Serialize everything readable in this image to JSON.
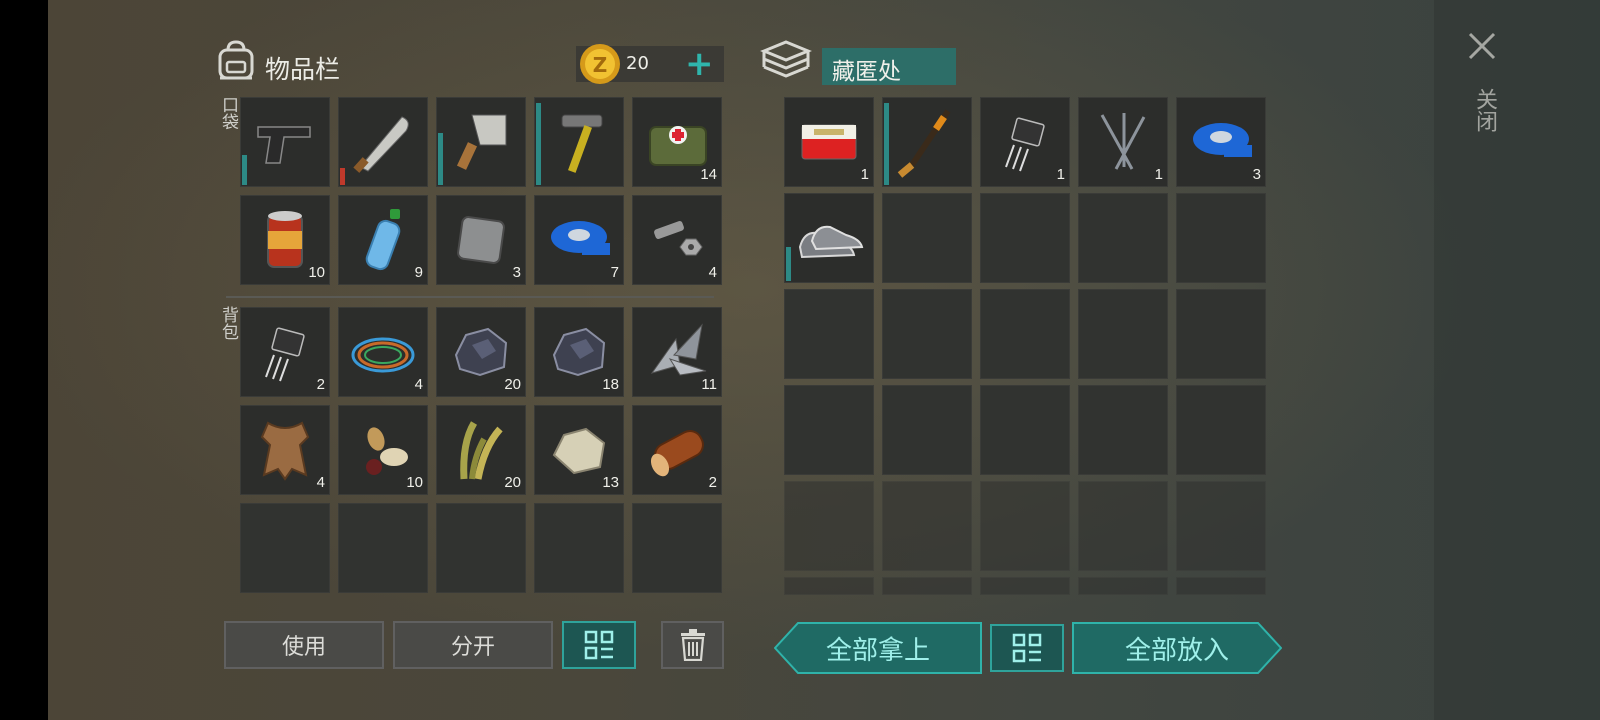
{
  "inventory": {
    "title": "物品栏",
    "coins": "20",
    "pocket_label": "口袋",
    "backpack_label": "背包",
    "pocket_items": [
      {
        "icon": "pistol-icon",
        "count": "",
        "durability": 0.35,
        "dur_color": "#2d8a86"
      },
      {
        "icon": "machete-icon",
        "count": "",
        "durability": 0.2,
        "dur_color": "#c0392b"
      },
      {
        "icon": "cleaver-icon",
        "count": "",
        "durability": 0.6,
        "dur_color": "#2d8a86"
      },
      {
        "icon": "hammer-icon",
        "count": "",
        "durability": 0.95,
        "dur_color": "#2d8a86"
      },
      {
        "icon": "medkit-bag-icon",
        "count": "14"
      },
      {
        "icon": "canned-food-icon",
        "count": "10"
      },
      {
        "icon": "water-bottle-icon",
        "count": "9"
      },
      {
        "icon": "metal-plate-icon",
        "count": "3"
      },
      {
        "icon": "duct-tape-icon",
        "count": "7"
      },
      {
        "icon": "bolt-nut-icon",
        "count": "4"
      }
    ],
    "backpack_items": [
      {
        "icon": "transistor-icon",
        "count": "2"
      },
      {
        "icon": "wire-coil-icon",
        "count": "4"
      },
      {
        "icon": "iron-ore-icon",
        "count": "20"
      },
      {
        "icon": "iron-ore-icon",
        "count": "18"
      },
      {
        "icon": "scrap-metal-icon",
        "count": "11"
      },
      {
        "icon": "leather-hide-icon",
        "count": "4"
      },
      {
        "icon": "seeds-icon",
        "count": "10"
      },
      {
        "icon": "plant-fiber-icon",
        "count": "20"
      },
      {
        "icon": "stone-icon",
        "count": "13"
      },
      {
        "icon": "wood-log-icon",
        "count": "2"
      }
    ],
    "buttons": {
      "use": "使用",
      "split": "分开"
    }
  },
  "stash": {
    "title": "藏匿处",
    "items": [
      {
        "icon": "cigarettes-icon",
        "count": "1"
      },
      {
        "icon": "hockey-stick-icon",
        "count": "",
        "durability": 0.95,
        "dur_color": "#2d8a86"
      },
      {
        "icon": "transistor-icon",
        "count": "1"
      },
      {
        "icon": "nails-icon",
        "count": "1"
      },
      {
        "icon": "duct-tape-icon",
        "count": "3"
      },
      {
        "icon": "sneakers-icon",
        "count": "",
        "durability": 0.4,
        "dur_color": "#2d8a86"
      }
    ],
    "buttons": {
      "take_all": "全部拿上",
      "put_all": "全部放入"
    }
  },
  "close": {
    "label": "关闭"
  },
  "colors": {
    "accent": "#2fa39b",
    "teal_dark": "#1d5652",
    "slot": "#2c2d2b"
  }
}
